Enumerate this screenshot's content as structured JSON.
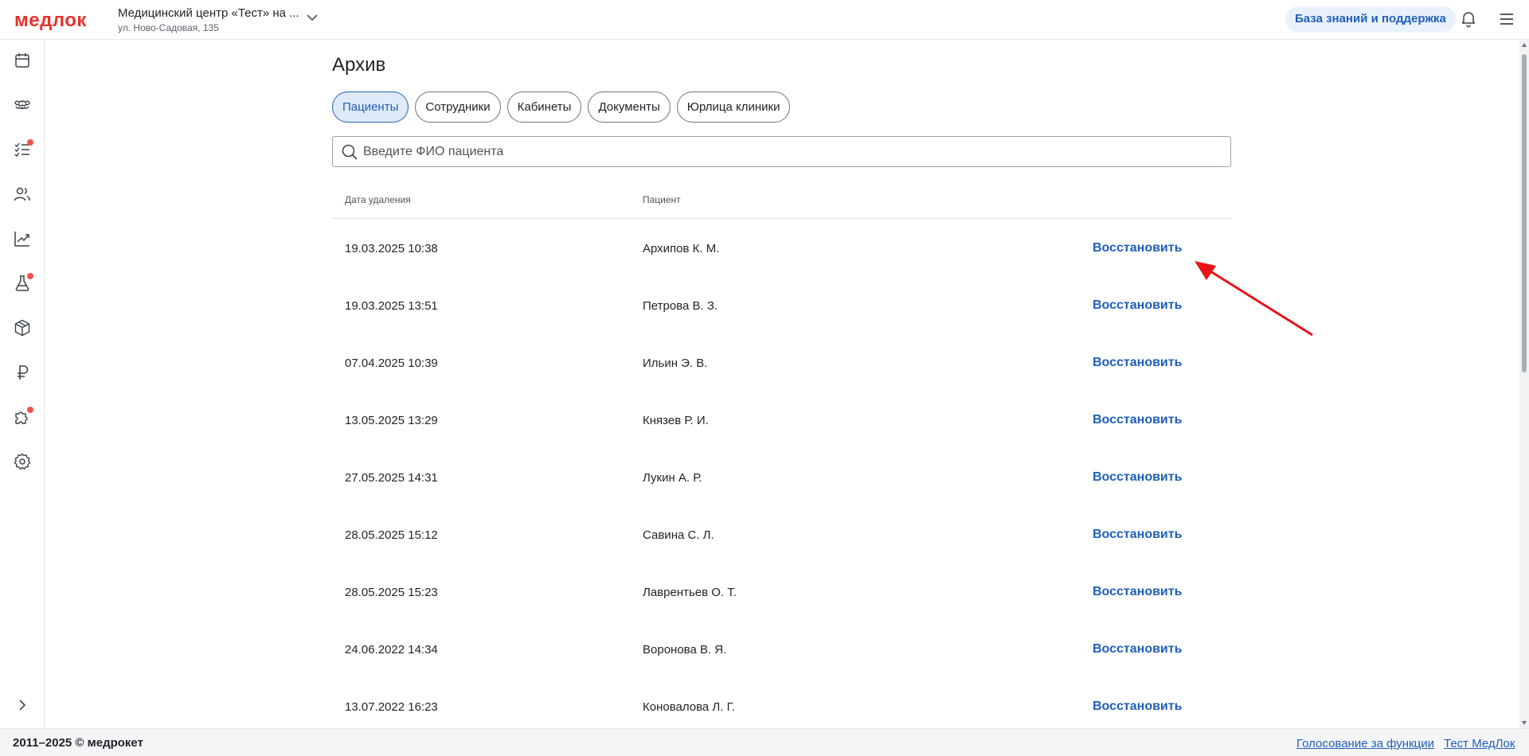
{
  "header": {
    "logo": "медлок",
    "clinic_name": "Медицинский центр «Тест» на ...",
    "clinic_address": "ул. Ново-Садовая, 135",
    "kb_button": "База знаний и поддержка"
  },
  "sidebar": {
    "items": [
      {
        "icon": "calendar-icon",
        "badge": false
      },
      {
        "icon": "tooth-icon",
        "badge": false
      },
      {
        "icon": "task-list-icon",
        "badge": true
      },
      {
        "icon": "users-icon",
        "badge": false
      },
      {
        "icon": "chart-icon",
        "badge": false
      },
      {
        "icon": "flask-icon",
        "badge": true
      },
      {
        "icon": "box-icon",
        "badge": false
      },
      {
        "icon": "ruble-icon",
        "badge": false
      },
      {
        "icon": "puzzle-icon",
        "badge": true
      },
      {
        "icon": "gear-icon",
        "badge": false
      }
    ]
  },
  "page": {
    "title": "Архив",
    "tabs": [
      {
        "label": "Пациенты",
        "active": true
      },
      {
        "label": "Сотрудники",
        "active": false
      },
      {
        "label": "Кабинеты",
        "active": false
      },
      {
        "label": "Документы",
        "active": false
      },
      {
        "label": "Юрлица клиники",
        "active": false
      }
    ],
    "search_placeholder": "Введите ФИО пациента"
  },
  "table": {
    "headers": {
      "date": "Дата удаления",
      "patient": "Пациент"
    },
    "rows": [
      {
        "date": "19.03.2025 10:38",
        "patient": "Архипов К. М.",
        "action": "Восстановить"
      },
      {
        "date": "19.03.2025 13:51",
        "patient": "Петрова В. З.",
        "action": "Восстановить"
      },
      {
        "date": "07.04.2025 10:39",
        "patient": "Ильин Э. В.",
        "action": "Восстановить"
      },
      {
        "date": "13.05.2025 13:29",
        "patient": "Князев Р. И.",
        "action": "Восстановить"
      },
      {
        "date": "27.05.2025 14:31",
        "patient": "Лукин А. Р.",
        "action": "Восстановить"
      },
      {
        "date": "28.05.2025 15:12",
        "patient": "Савина С. Л.",
        "action": "Восстановить"
      },
      {
        "date": "28.05.2025 15:23",
        "patient": "Лаврентьев О. Т.",
        "action": "Восстановить"
      },
      {
        "date": "24.06.2022 14:34",
        "patient": "Воронова В. Я.",
        "action": "Восстановить"
      },
      {
        "date": "13.07.2022 16:23",
        "patient": "Коновалова Л. Г.",
        "action": "Восстановить"
      }
    ]
  },
  "footer": {
    "copyright": "2011–2025 © медрокет",
    "link_voting": "Голосование за функции",
    "link_test": "Тест МедЛок"
  },
  "colors": {
    "brand": "#e8322d",
    "accent": "#1f5fb8",
    "badge": "#f0524b",
    "annotation_arrow": "#e8141a"
  }
}
